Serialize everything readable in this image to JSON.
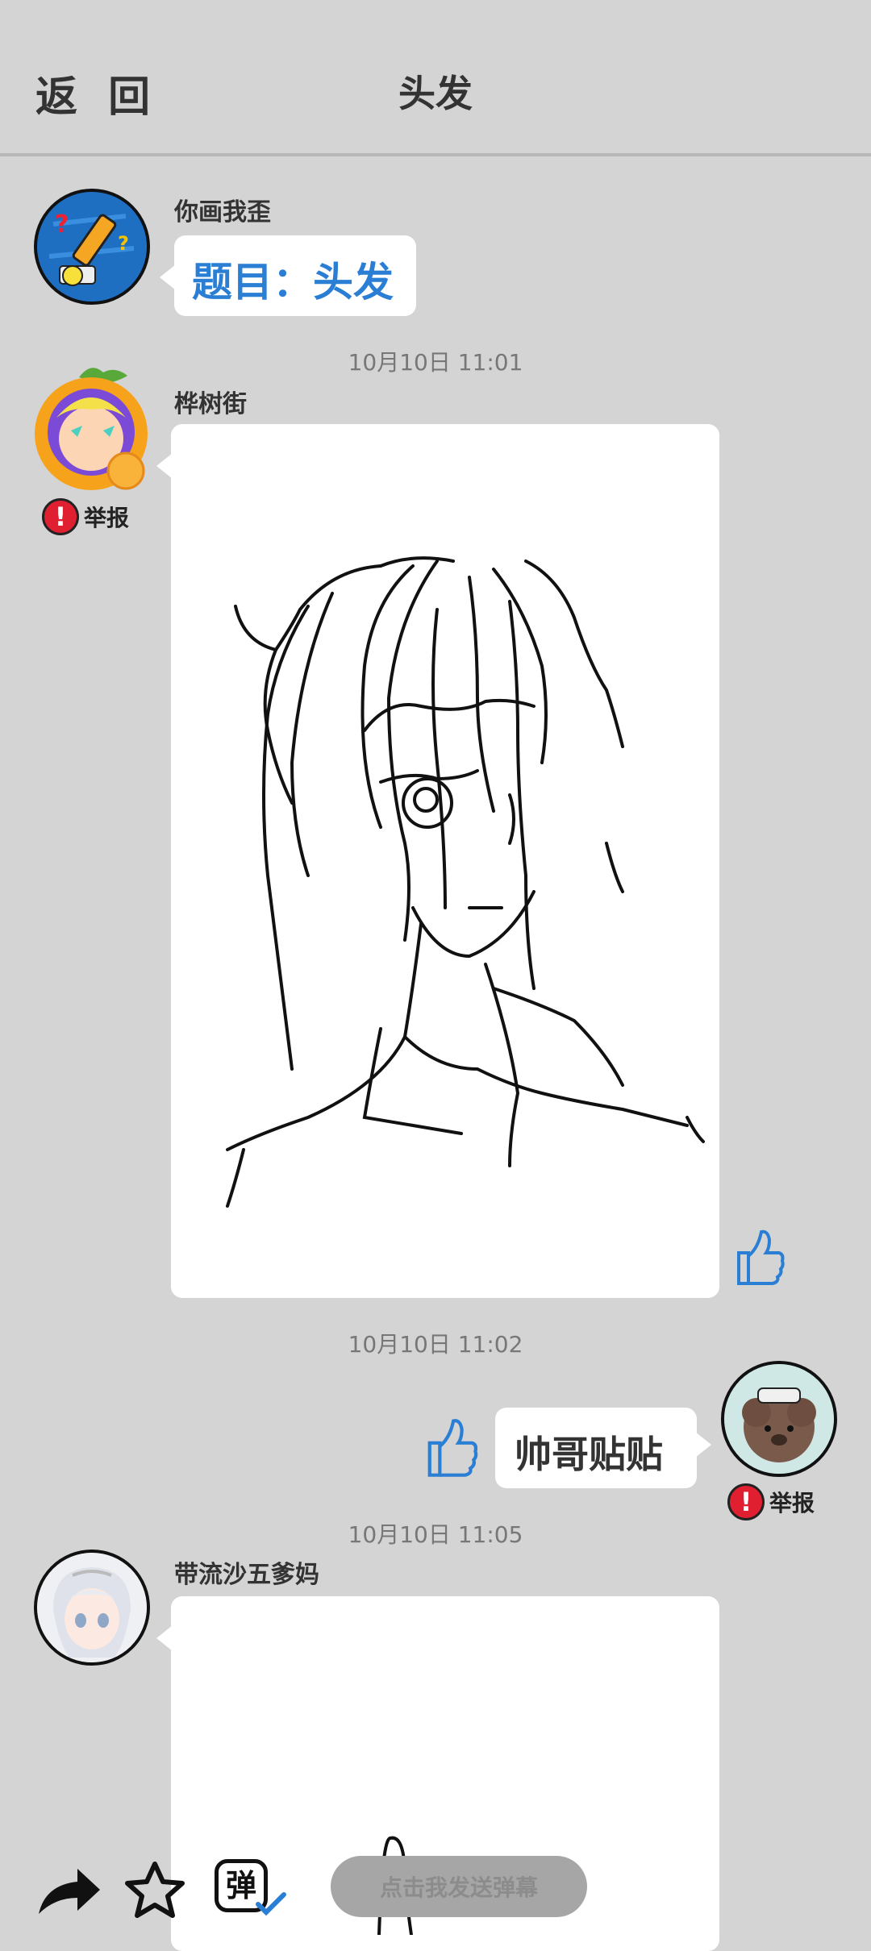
{
  "header": {
    "back_label": "返 回",
    "title": "头发"
  },
  "messages": [
    {
      "user": "你画我歪",
      "text": "题目：头发"
    },
    {
      "timestamp": "10月10日  11:01",
      "user": "桦树街",
      "report_label": "举报"
    },
    {
      "timestamp": "10月10日  11:02",
      "text": "帅哥贴贴",
      "report_label": "举报"
    },
    {
      "timestamp": "10月10日  11:05",
      "user": "带流沙五爹妈"
    }
  ],
  "toolbar": {
    "danmu_placeholder": "点击我发送弹幕",
    "danmu_button_label": "弹"
  },
  "colors": {
    "accent_blue": "#2a7fd4",
    "report_red": "#e02030",
    "background": "#d4d4d4"
  }
}
